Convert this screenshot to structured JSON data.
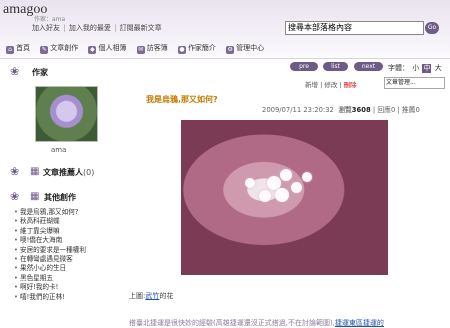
{
  "header": {
    "blog_name": "amagoo",
    "author_line": "作家：ama",
    "top_links": [
      "加入好友",
      "加入我的最愛",
      "訂閱最新文章"
    ],
    "search_placeholder": "搜尋本部落格內容",
    "go_label": "Go"
  },
  "nav": [
    "首頁",
    "文章創作",
    "個人相簿",
    "訪客簿",
    "作家簡介",
    "管理中心"
  ],
  "sidebar": {
    "author_title": "作家",
    "avatar_name": "ama",
    "recommend_title": "文章推薦人",
    "recommend_count": "(0)",
    "works_title": "其他創作",
    "works": [
      "我是烏鴉,那又如何?",
      "秋高科莊蝴蝶",
      "維丁靠尖爆嘛",
      "噢!僑在大海南",
      "安居的要求是一種權利",
      "在轉彎處遇見微客",
      "果然小心的生日",
      "黑色星期五",
      "啊好!我的卡!",
      "嘻!我們的正林!"
    ]
  },
  "toolbar": {
    "pre": "pre",
    "list": "list",
    "next": "next",
    "font_label": "字體：",
    "font_small": "小",
    "font_medium": "中",
    "font_large": "大",
    "actions": [
      "新增",
      "修改",
      "刪除"
    ],
    "manage_select": "文章管理..."
  },
  "post": {
    "title": "我是烏鴉,那又如何?",
    "datetime": "2009/07/11 23:20:32",
    "views_label": "瀏覽",
    "views": "3608",
    "reply_label": "回應",
    "replies": "0",
    "recommend_label": "推薦",
    "recommends": "0",
    "caption_prefix": "上圖:",
    "caption_link": "武竹",
    "caption_suffix": "的花",
    "body_plain": "搭臺北捷運是很快妙的經驗(高雄捷運還沒正式搭過,不在討論範圍),",
    "body_link": "捷運東區捷運的"
  }
}
